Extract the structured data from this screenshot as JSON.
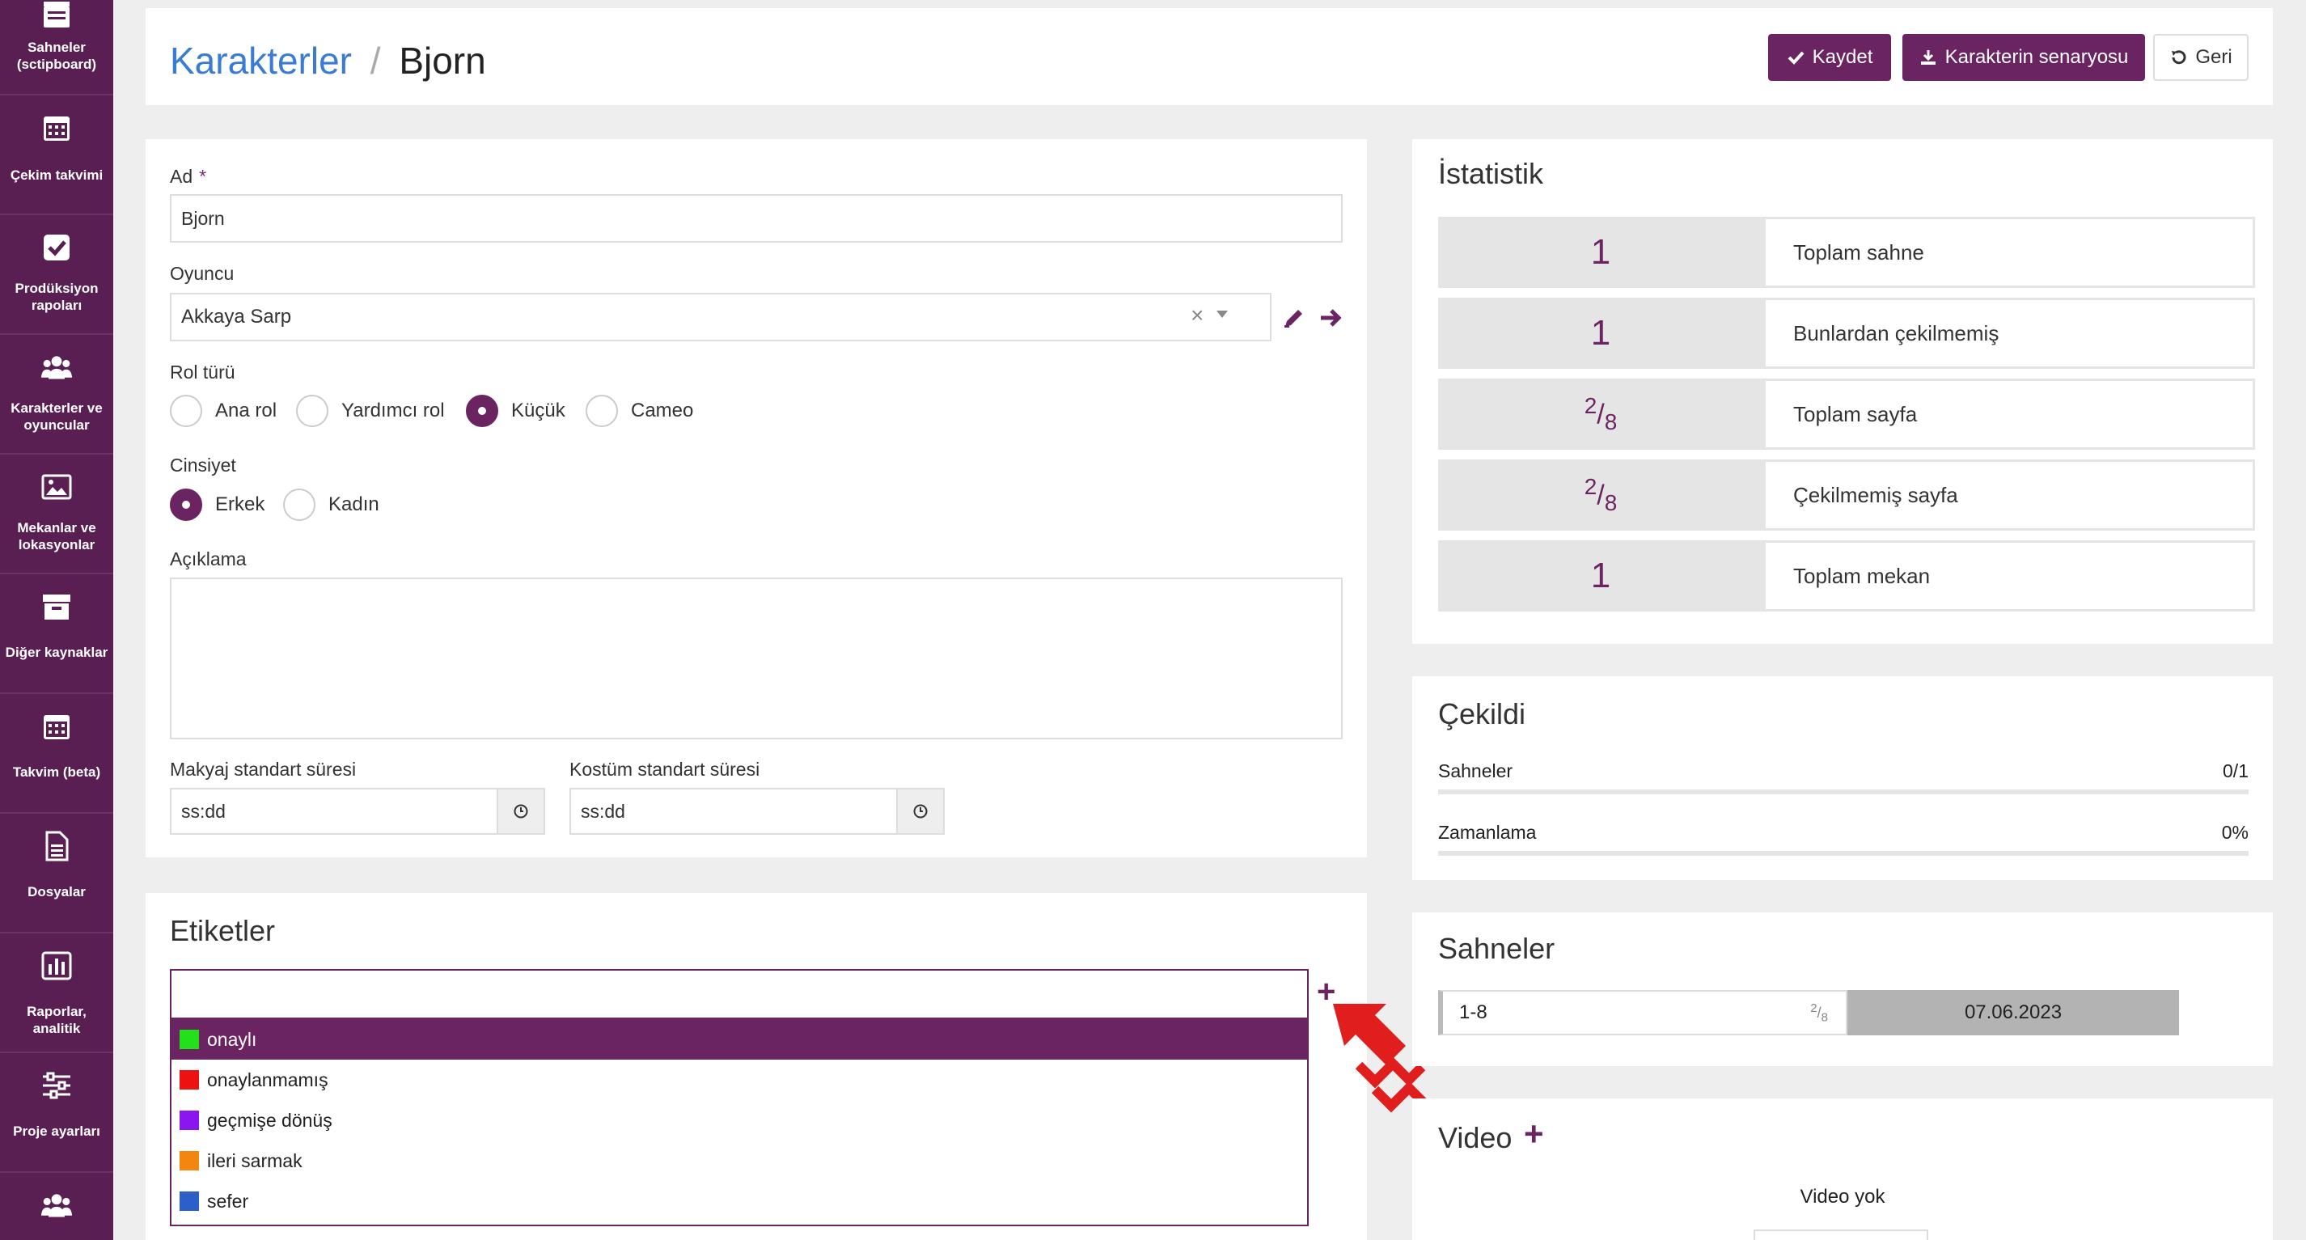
{
  "sidebar": {
    "items": [
      {
        "label": "Sahneler (sctipboard)",
        "icon": "clapperboard-icon"
      },
      {
        "label": "Çekim takvimi",
        "icon": "calendar-icon"
      },
      {
        "label": "Prodüksiyon rapoları",
        "icon": "checkbox-icon"
      },
      {
        "label": "Karakterler ve oyuncular",
        "icon": "users-icon"
      },
      {
        "label": "Mekanlar ve lokasyonlar",
        "icon": "image-icon"
      },
      {
        "label": "Diğer kaynaklar",
        "icon": "archive-icon"
      },
      {
        "label": "Takvim (beta)",
        "icon": "calendar-grid-icon"
      },
      {
        "label": "Dosyalar",
        "icon": "document-icon"
      },
      {
        "label": "Raporlar, analitik",
        "icon": "bar-chart-icon"
      },
      {
        "label": "Proje ayarları",
        "icon": "sliders-icon"
      },
      {
        "label": "",
        "icon": "users-icon"
      }
    ]
  },
  "header": {
    "breadcrumb_parent": "Karakterler",
    "separator": "/",
    "title": "Bjorn",
    "save_label": "Kaydet",
    "script_label": "Karakterin senaryosu",
    "back_label": "Geri"
  },
  "form": {
    "name_label": "Ad",
    "required_mark": "*",
    "name_value": "Bjorn",
    "actor_label": "Oyuncu",
    "actor_value": "Akkaya Sarp",
    "clear_glyph": "×",
    "role_label": "Rol türü",
    "roles": [
      "Ana rol",
      "Yardımcı rol",
      "Küçük",
      "Cameo"
    ],
    "role_selected": "Küçük",
    "gender_label": "Cinsiyet",
    "genders": [
      "Erkek",
      "Kadın"
    ],
    "gender_selected": "Erkek",
    "description_label": "Açıklama",
    "description_value": "",
    "makeup_label": "Makyaj standart süresi",
    "makeup_placeholder": "ss:dd",
    "costume_label": "Kostüm standart süresi",
    "costume_placeholder": "ss:dd"
  },
  "tags": {
    "title": "Etiketler",
    "input_value": "",
    "add_glyph": "+",
    "options": [
      {
        "label": "onaylı",
        "color": "#22e01a"
      },
      {
        "label": "onaylanmamış",
        "color": "#ee1111"
      },
      {
        "label": "geçmişe dönüş",
        "color": "#8b16f0"
      },
      {
        "label": "ileri sarmak",
        "color": "#f2860e"
      },
      {
        "label": "sefer",
        "color": "#2d5fc8"
      }
    ],
    "active_option": "onaylı"
  },
  "stats": {
    "title": "İstatistik",
    "rows": [
      {
        "value": "1",
        "label": "Toplam sahne"
      },
      {
        "value": "1",
        "label": "Bunlardan çekilmemiş"
      },
      {
        "numerator": "2",
        "denominator": "8",
        "label": "Toplam sayfa"
      },
      {
        "numerator": "2",
        "denominator": "8",
        "label": "Çekilmemiş sayfa"
      },
      {
        "value": "1",
        "label": "Toplam mekan"
      }
    ]
  },
  "shot": {
    "title": "Çekildi",
    "scenes_label": "Sahneler",
    "scenes_value": "0/1",
    "scenes_progress": 0,
    "timing_label": "Zamanlama",
    "timing_value": "0%",
    "timing_progress": 0
  },
  "scenes": {
    "title": "Sahneler",
    "row": {
      "number": "1-8",
      "numerator": "2",
      "denominator": "8",
      "date": "07.06.2023"
    }
  },
  "video": {
    "title": "Video",
    "add_glyph": "+",
    "empty_text": "Video yok"
  },
  "colors": {
    "sidebar": "#5a1f52",
    "primary": "#6b2462",
    "link": "#3a7bd5",
    "annotation_arrow": "#e01e1e"
  }
}
